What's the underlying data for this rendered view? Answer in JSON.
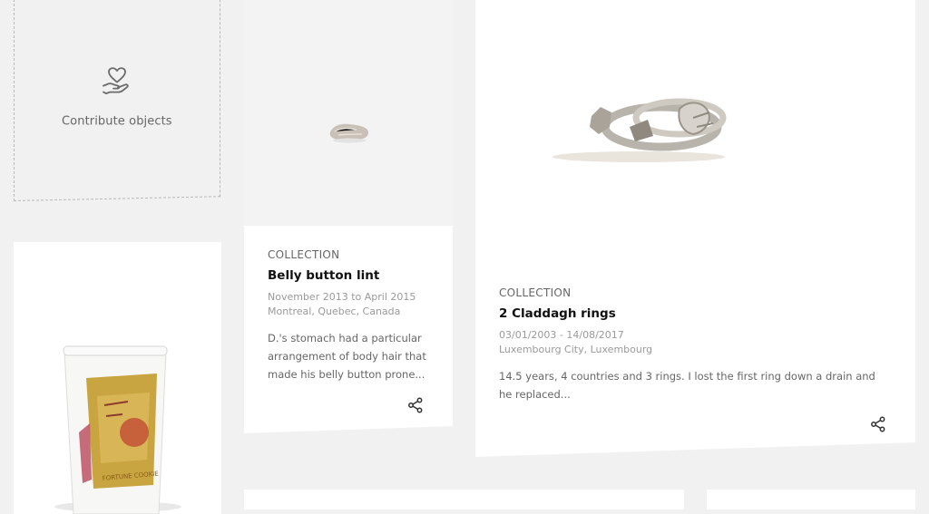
{
  "contribute": {
    "label": "Contribute objects",
    "icon": "heart-hand-icon"
  },
  "cards": [
    {
      "category": "COLLECTION",
      "title": "Belly button lint",
      "date": "November 2013 to April 2015",
      "place": "Montreal, Quebec, Canada",
      "description": "D.'s stomach had a particular arrangement of body hair that made his belly button prone...",
      "share_icon": "share-icon"
    },
    {
      "category": "COLLECTION",
      "title": "2 Claddagh rings",
      "date": "03/01/2003 - 14/08/2017",
      "place": "Luxembourg City, Luxembourg",
      "description": "14.5 years, 4 countries and 3 rings. I lost the first ring down a drain and he replaced...",
      "share_icon": "share-icon"
    }
  ],
  "colors": {
    "background": "#f1f1f1",
    "card": "#ffffff",
    "image_bg": "#f3f3f3",
    "text": "#111111",
    "muted": "#9a9a9a"
  }
}
